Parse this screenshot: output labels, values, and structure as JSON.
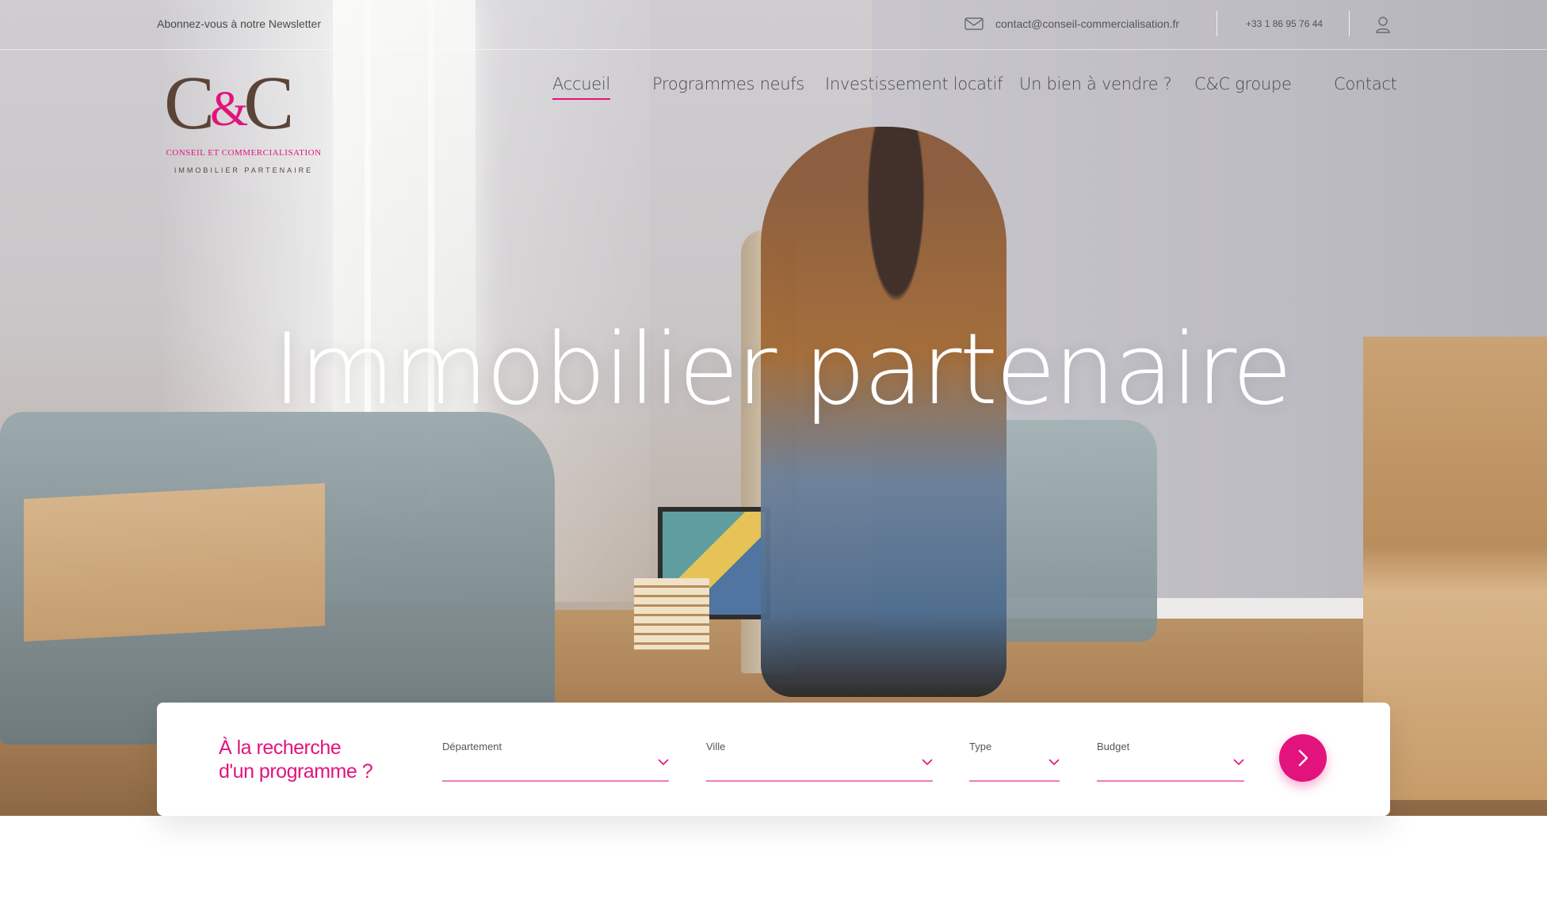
{
  "topbar": {
    "newsletter": "Abonnez-vous à notre Newsletter",
    "email": "contact@conseil-commercialisation.fr",
    "phone": "+33 1 86 95 76 44",
    "icons": [
      "mail-icon",
      "user-icon"
    ]
  },
  "logo": {
    "left": "C",
    "amp": "&",
    "right": "C",
    "subtitle": "CONSEIL ET COMMERCIALISATION",
    "tagline": "IMMOBILIER PARTENAIRE"
  },
  "nav": {
    "items": [
      {
        "label": "Accueil",
        "active": true
      },
      {
        "label": "Programmes neufs",
        "active": false
      },
      {
        "label": "Investissement locatif",
        "active": false
      },
      {
        "label": "Un bien à vendre ?",
        "active": false
      },
      {
        "label": "C&C groupe",
        "active": false
      },
      {
        "label": "Contact",
        "active": false
      }
    ]
  },
  "hero": {
    "headline": "Immobilier partenaire"
  },
  "search": {
    "title_line1": "À la recherche",
    "title_line2": "d'un programme ?",
    "fields": [
      {
        "label": "Département",
        "value": ""
      },
      {
        "label": "Ville",
        "value": ""
      },
      {
        "label": "Type",
        "value": ""
      },
      {
        "label": "Budget",
        "value": ""
      }
    ],
    "submit_icon": "chevron-right-icon"
  },
  "colors": {
    "accent": "#e2137d",
    "logo_brown": "#5a4437",
    "text": "#4a4a4a"
  }
}
